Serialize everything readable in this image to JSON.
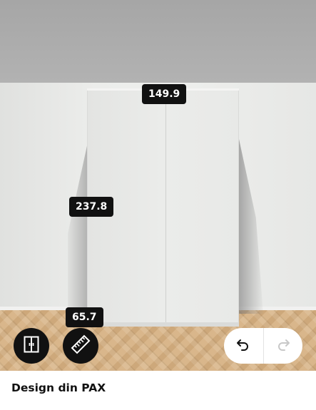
{
  "measurements": {
    "width": "149.9",
    "height": "237.8",
    "depth": "65.7"
  },
  "toolbar": {
    "doors_icon": "wardrobe-doors-icon",
    "measure_icon": "ruler-icon"
  },
  "history": {
    "undo_icon": "undo-icon",
    "redo_icon": "redo-icon"
  },
  "footer": {
    "title": "Design din PAX"
  },
  "colors": {
    "button": "#111111",
    "ceiling": "#a6a6a6",
    "wall": "#ecedeb",
    "floor": "#d7b284"
  }
}
